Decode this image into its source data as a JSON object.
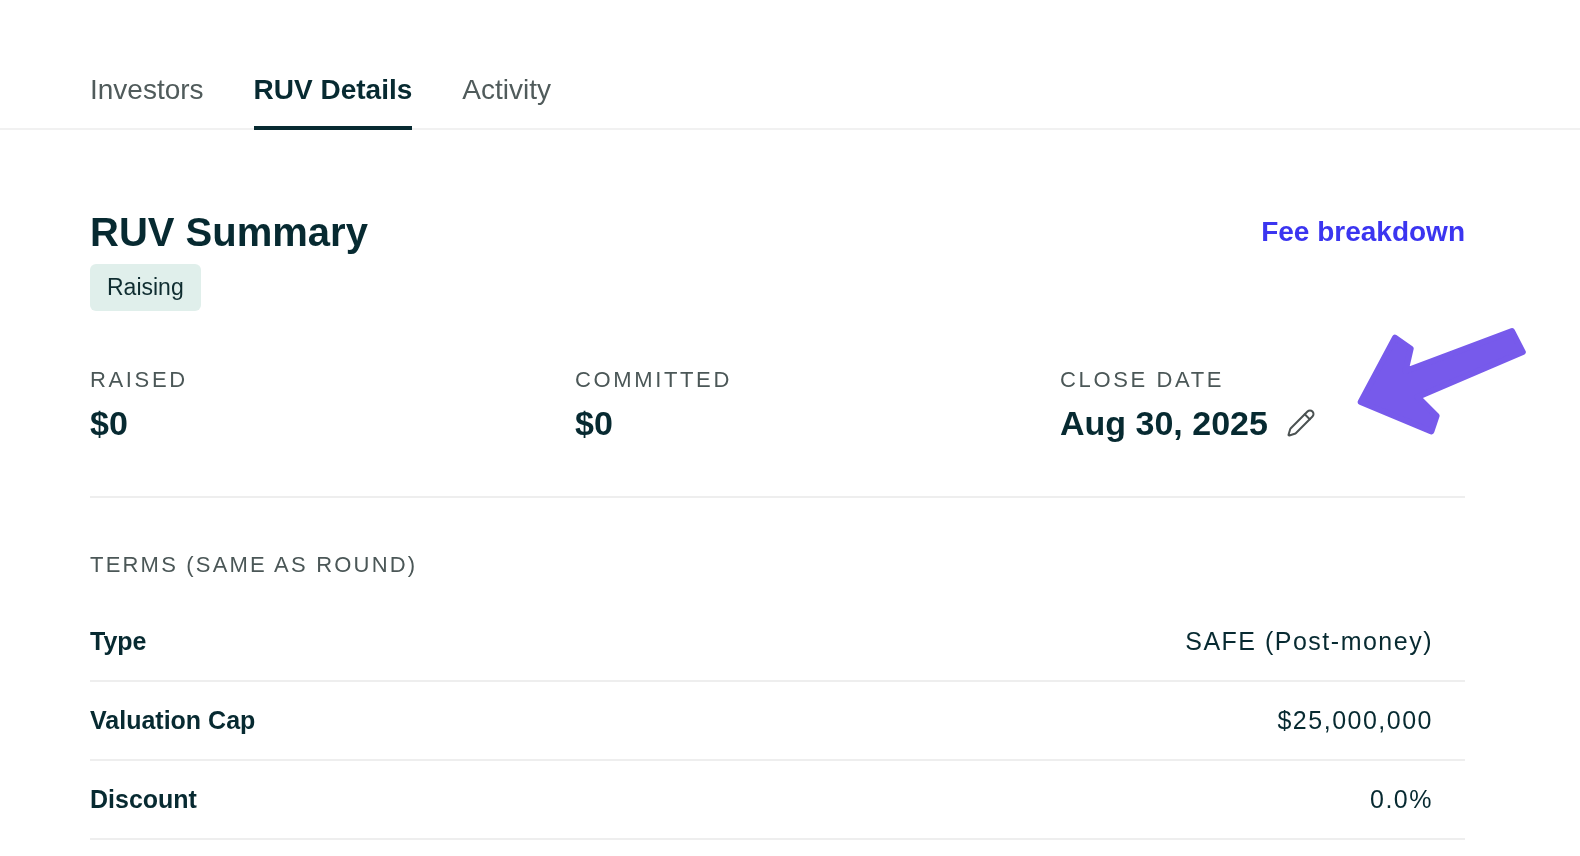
{
  "tabs": [
    {
      "label": "Investors",
      "selected": false
    },
    {
      "label": "RUV Details",
      "selected": true
    },
    {
      "label": "Activity",
      "selected": false
    }
  ],
  "summary": {
    "title": "RUV Summary",
    "status": "Raising",
    "link": "Fee breakdown",
    "stats": [
      {
        "label": "RAISED",
        "value": "$0",
        "editable": false
      },
      {
        "label": "COMMITTED",
        "value": "$0",
        "editable": false
      },
      {
        "label": "CLOSE DATE",
        "value": "Aug 30, 2025",
        "editable": true
      }
    ]
  },
  "terms": {
    "heading": "TERMS (SAME AS ROUND)",
    "rows": [
      {
        "label": "Type",
        "value": "SAFE (Post-money)"
      },
      {
        "label": "Valuation Cap",
        "value": "$25,000,000"
      },
      {
        "label": "Discount",
        "value": "0.0%"
      }
    ]
  }
}
